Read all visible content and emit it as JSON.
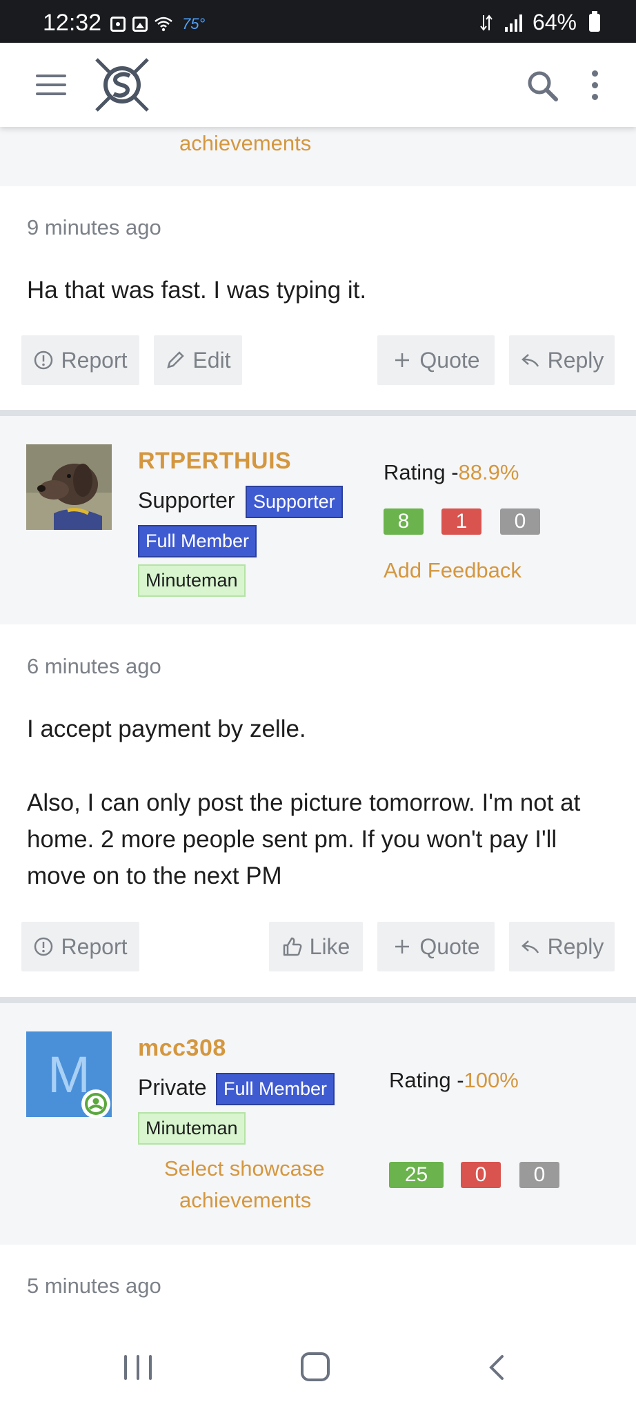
{
  "status_bar": {
    "time": "12:32",
    "temperature": "75°",
    "battery": "64%"
  },
  "app_bar": {
    "menu_icon": "hamburger-icon",
    "logo": "site-logo",
    "search_icon": "search-icon",
    "more_icon": "more-vertical-icon"
  },
  "prev_post_tail": {
    "achievements_text": "achievements"
  },
  "post1": {
    "time": "9 minutes ago",
    "text": "Ha that was fast. I was typing it.",
    "buttons": {
      "report": "Report",
      "edit": "Edit",
      "quote": "Quote",
      "reply": "Reply"
    }
  },
  "user2": {
    "name": "RTPERTHUIS",
    "role": "Supporter",
    "badges": [
      "Supporter",
      "Full Member"
    ],
    "green_badge": "Minuteman",
    "rating_label": "Rating -",
    "rating_value": "88.9%",
    "counts": [
      "8",
      "1",
      "0"
    ],
    "feedback_link": "Add Feedback"
  },
  "post2": {
    "time": "6 minutes ago",
    "line1": "I accept payment by zelle.",
    "line2": "Also, I can only post the picture tomorrow. I'm not at home. 2 more people sent pm. If you won't pay I'll move on to the next PM",
    "buttons": {
      "report": "Report",
      "like": "Like",
      "quote": "Quote",
      "reply": "Reply"
    }
  },
  "user3": {
    "initial": "M",
    "name": "mcc308",
    "role": "Private",
    "badge": "Full Member",
    "green_badge": "Minuteman",
    "rating_label": "Rating -",
    "rating_value": "100%",
    "showcase_line1": "Select showcase",
    "showcase_line2": "achievements",
    "counts": [
      "25",
      "0",
      "0"
    ],
    "avatar_color": "#4a90d9"
  },
  "post3": {
    "time": "5 minutes ago"
  },
  "colors": {
    "accent": "#d4973f",
    "badge_blue": "#3f5bd1",
    "green": "#6bb34c",
    "red": "#d9534f",
    "gray": "#9a9a9a"
  }
}
